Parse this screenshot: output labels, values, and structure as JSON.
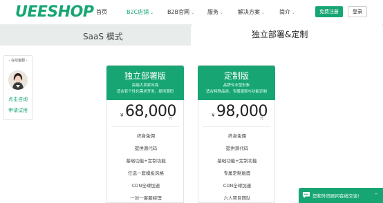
{
  "header": {
    "logo": "UEESHOP",
    "nav": [
      {
        "label": "首页",
        "has_menu": false
      },
      {
        "label": "B2C店铺",
        "has_menu": true,
        "active": true
      },
      {
        "label": "B2B官网",
        "has_menu": true
      },
      {
        "label": "服务",
        "has_menu": true
      },
      {
        "label": "解决方案",
        "has_menu": true
      },
      {
        "label": "简介",
        "has_menu": true
      }
    ],
    "register_label": "免费注册",
    "login_label": "登录"
  },
  "tabs": {
    "saas": "SaaS 模式",
    "local": "独立部署&定制"
  },
  "consult": {
    "title": "- 在线客服 -",
    "link1": "点击咨询",
    "link2": "申请试用"
  },
  "cards": [
    {
      "name": "独立部署版",
      "sub1": "高端大卖家出海",
      "sub2": "适合有个性化需求开发，提供源码",
      "currency": "¥",
      "price": "68,000",
      "unit": "元",
      "features": [
        "终身免佣",
        "提供源代码",
        "基础功能+定制功能",
        "任选一套模板风格",
        "CDN全球加速",
        "一对一客服经理"
      ]
    },
    {
      "name": "定制版",
      "sub1": "品牌专业型形象",
      "sub2": "适合特殊品类，专属版面与功能定制",
      "currency": "¥",
      "price": "98,000",
      "unit": "元",
      "features": [
        "终身免佣",
        "提供源代码",
        "基础功能+定制功能",
        "专属定制版面",
        "CDN全球加速",
        "六人项目团队"
      ]
    }
  ],
  "chat": {
    "text": "您和外贸顾问在线交谈!",
    "icon": "chat-bubble-icon"
  },
  "colors": {
    "brand": "#17a673"
  }
}
